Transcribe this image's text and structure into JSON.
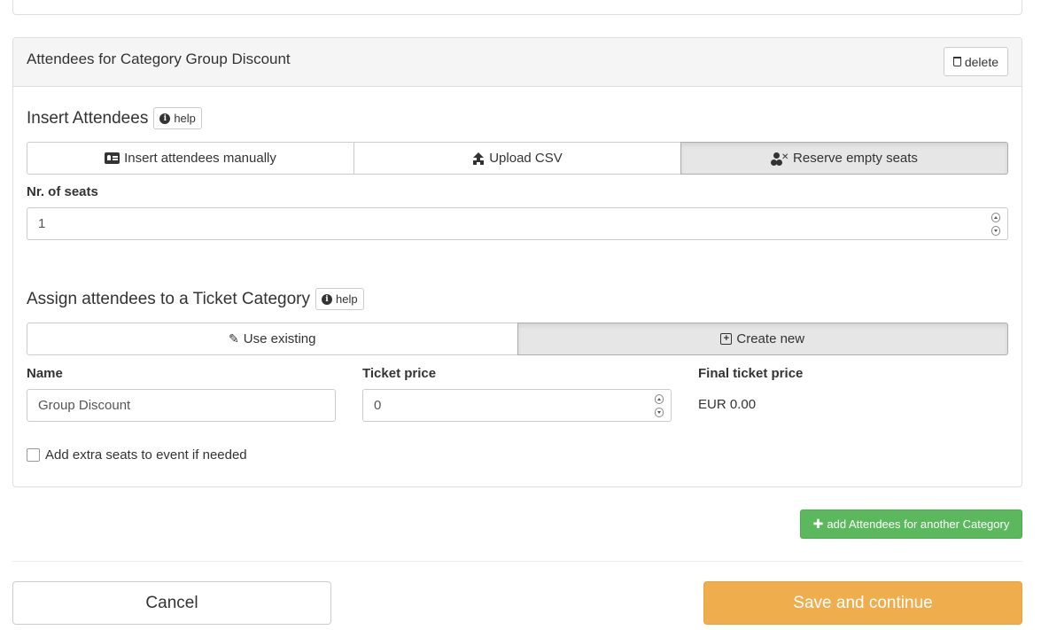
{
  "panel": {
    "title": "Attendees for Category Group Discount",
    "delete_label": "delete"
  },
  "insert": {
    "title": "Insert Attendees",
    "help_label": "help",
    "options": [
      {
        "label": "Insert attendees manually",
        "icon": "id-card-icon",
        "active": false
      },
      {
        "label": "Upload CSV",
        "icon": "upload-icon",
        "active": false
      },
      {
        "label": "Reserve empty seats",
        "icon": "user-times-icon",
        "active": true
      }
    ],
    "seats_label": "Nr. of seats",
    "seats_value": "1"
  },
  "assign": {
    "title": "Assign attendees to a Ticket Category",
    "help_label": "help",
    "options": [
      {
        "label": "Use existing",
        "icon": "paperclip-icon",
        "active": false
      },
      {
        "label": "Create new",
        "icon": "plus-square-icon",
        "active": true
      }
    ],
    "name_label": "Name",
    "name_value": "Group Discount",
    "price_label": "Ticket price",
    "price_value": "0",
    "final_price_label": "Final ticket price",
    "final_price_value": "EUR 0.00"
  },
  "extra_seats": {
    "label": "Add extra seats to event if needed",
    "checked": false
  },
  "add_category_label": "add Attendees for another Category",
  "footer": {
    "cancel_label": "Cancel",
    "save_label": "Save and continue"
  },
  "colors": {
    "success": "#5cb85c",
    "warning": "#f0ad4e",
    "active_segment": "#e6e6e6",
    "panel_heading": "#f5f5f5"
  }
}
